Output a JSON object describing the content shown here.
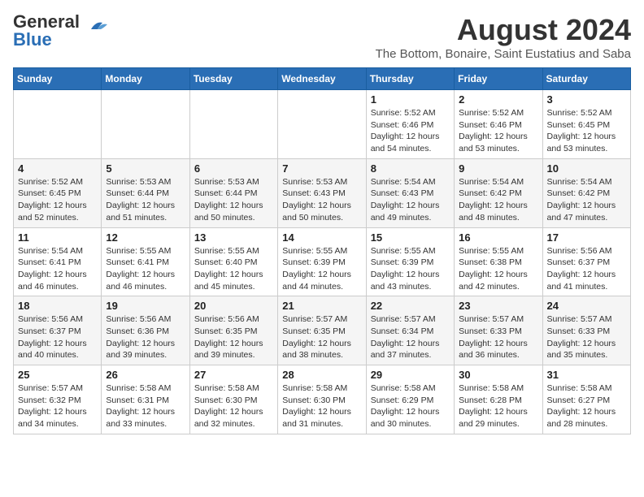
{
  "header": {
    "logo_general": "General",
    "logo_blue": "Blue",
    "main_title": "August 2024",
    "sub_title": "The Bottom, Bonaire, Saint Eustatius and Saba"
  },
  "weekdays": [
    "Sunday",
    "Monday",
    "Tuesday",
    "Wednesday",
    "Thursday",
    "Friday",
    "Saturday"
  ],
  "weeks": [
    [
      {
        "day": "",
        "info": ""
      },
      {
        "day": "",
        "info": ""
      },
      {
        "day": "",
        "info": ""
      },
      {
        "day": "",
        "info": ""
      },
      {
        "day": "1",
        "info": "Sunrise: 5:52 AM\nSunset: 6:46 PM\nDaylight: 12 hours\nand 54 minutes."
      },
      {
        "day": "2",
        "info": "Sunrise: 5:52 AM\nSunset: 6:46 PM\nDaylight: 12 hours\nand 53 minutes."
      },
      {
        "day": "3",
        "info": "Sunrise: 5:52 AM\nSunset: 6:45 PM\nDaylight: 12 hours\nand 53 minutes."
      }
    ],
    [
      {
        "day": "4",
        "info": "Sunrise: 5:52 AM\nSunset: 6:45 PM\nDaylight: 12 hours\nand 52 minutes."
      },
      {
        "day": "5",
        "info": "Sunrise: 5:53 AM\nSunset: 6:44 PM\nDaylight: 12 hours\nand 51 minutes."
      },
      {
        "day": "6",
        "info": "Sunrise: 5:53 AM\nSunset: 6:44 PM\nDaylight: 12 hours\nand 50 minutes."
      },
      {
        "day": "7",
        "info": "Sunrise: 5:53 AM\nSunset: 6:43 PM\nDaylight: 12 hours\nand 50 minutes."
      },
      {
        "day": "8",
        "info": "Sunrise: 5:54 AM\nSunset: 6:43 PM\nDaylight: 12 hours\nand 49 minutes."
      },
      {
        "day": "9",
        "info": "Sunrise: 5:54 AM\nSunset: 6:42 PM\nDaylight: 12 hours\nand 48 minutes."
      },
      {
        "day": "10",
        "info": "Sunrise: 5:54 AM\nSunset: 6:42 PM\nDaylight: 12 hours\nand 47 minutes."
      }
    ],
    [
      {
        "day": "11",
        "info": "Sunrise: 5:54 AM\nSunset: 6:41 PM\nDaylight: 12 hours\nand 46 minutes."
      },
      {
        "day": "12",
        "info": "Sunrise: 5:55 AM\nSunset: 6:41 PM\nDaylight: 12 hours\nand 46 minutes."
      },
      {
        "day": "13",
        "info": "Sunrise: 5:55 AM\nSunset: 6:40 PM\nDaylight: 12 hours\nand 45 minutes."
      },
      {
        "day": "14",
        "info": "Sunrise: 5:55 AM\nSunset: 6:39 PM\nDaylight: 12 hours\nand 44 minutes."
      },
      {
        "day": "15",
        "info": "Sunrise: 5:55 AM\nSunset: 6:39 PM\nDaylight: 12 hours\nand 43 minutes."
      },
      {
        "day": "16",
        "info": "Sunrise: 5:55 AM\nSunset: 6:38 PM\nDaylight: 12 hours\nand 42 minutes."
      },
      {
        "day": "17",
        "info": "Sunrise: 5:56 AM\nSunset: 6:37 PM\nDaylight: 12 hours\nand 41 minutes."
      }
    ],
    [
      {
        "day": "18",
        "info": "Sunrise: 5:56 AM\nSunset: 6:37 PM\nDaylight: 12 hours\nand 40 minutes."
      },
      {
        "day": "19",
        "info": "Sunrise: 5:56 AM\nSunset: 6:36 PM\nDaylight: 12 hours\nand 39 minutes."
      },
      {
        "day": "20",
        "info": "Sunrise: 5:56 AM\nSunset: 6:35 PM\nDaylight: 12 hours\nand 39 minutes."
      },
      {
        "day": "21",
        "info": "Sunrise: 5:57 AM\nSunset: 6:35 PM\nDaylight: 12 hours\nand 38 minutes."
      },
      {
        "day": "22",
        "info": "Sunrise: 5:57 AM\nSunset: 6:34 PM\nDaylight: 12 hours\nand 37 minutes."
      },
      {
        "day": "23",
        "info": "Sunrise: 5:57 AM\nSunset: 6:33 PM\nDaylight: 12 hours\nand 36 minutes."
      },
      {
        "day": "24",
        "info": "Sunrise: 5:57 AM\nSunset: 6:33 PM\nDaylight: 12 hours\nand 35 minutes."
      }
    ],
    [
      {
        "day": "25",
        "info": "Sunrise: 5:57 AM\nSunset: 6:32 PM\nDaylight: 12 hours\nand 34 minutes."
      },
      {
        "day": "26",
        "info": "Sunrise: 5:58 AM\nSunset: 6:31 PM\nDaylight: 12 hours\nand 33 minutes."
      },
      {
        "day": "27",
        "info": "Sunrise: 5:58 AM\nSunset: 6:30 PM\nDaylight: 12 hours\nand 32 minutes."
      },
      {
        "day": "28",
        "info": "Sunrise: 5:58 AM\nSunset: 6:30 PM\nDaylight: 12 hours\nand 31 minutes."
      },
      {
        "day": "29",
        "info": "Sunrise: 5:58 AM\nSunset: 6:29 PM\nDaylight: 12 hours\nand 30 minutes."
      },
      {
        "day": "30",
        "info": "Sunrise: 5:58 AM\nSunset: 6:28 PM\nDaylight: 12 hours\nand 29 minutes."
      },
      {
        "day": "31",
        "info": "Sunrise: 5:58 AM\nSunset: 6:27 PM\nDaylight: 12 hours\nand 28 minutes."
      }
    ]
  ]
}
